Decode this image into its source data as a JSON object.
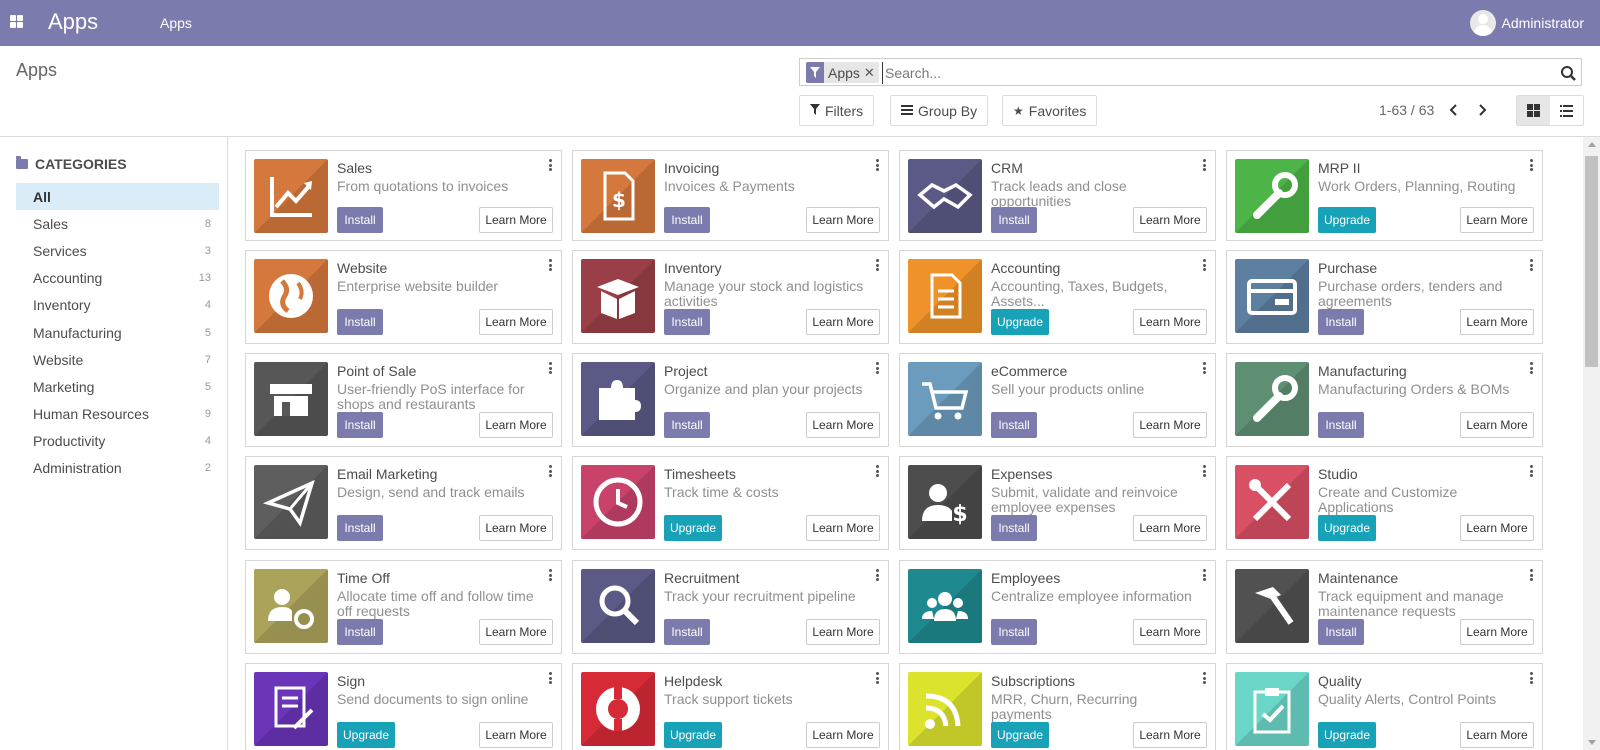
{
  "navbar": {
    "brand": "Apps",
    "menu_item": "Apps",
    "user": "Administrator",
    "color": "#7c7bad"
  },
  "control": {
    "title": "Apps",
    "search": {
      "facet": "Apps",
      "placeholder": "Search..."
    },
    "buttons": {
      "filters": "Filters",
      "group_by": "Group By",
      "favorites": "Favorites"
    },
    "pager": "1-63 / 63",
    "view": "kanban"
  },
  "sidebar": {
    "header": "CATEGORIES",
    "items": [
      {
        "label": "All",
        "count": "",
        "active": true
      },
      {
        "label": "Sales",
        "count": "8"
      },
      {
        "label": "Services",
        "count": "3"
      },
      {
        "label": "Accounting",
        "count": "13"
      },
      {
        "label": "Inventory",
        "count": "4"
      },
      {
        "label": "Manufacturing",
        "count": "5"
      },
      {
        "label": "Website",
        "count": "7"
      },
      {
        "label": "Marketing",
        "count": "5"
      },
      {
        "label": "Human Resources",
        "count": "9"
      },
      {
        "label": "Productivity",
        "count": "4"
      },
      {
        "label": "Administration",
        "count": "2"
      }
    ]
  },
  "learn_more_label": "Learn More",
  "apps": [
    {
      "name": "Sales",
      "summary": "From quotations to invoices",
      "action": "Install",
      "color": "#d4783d",
      "icon": "chart-icon"
    },
    {
      "name": "Invoicing",
      "summary": "Invoices & Payments",
      "action": "Install",
      "color": "#d4783d",
      "icon": "invoice-icon"
    },
    {
      "name": "CRM",
      "summary": "Track leads and close opportunities",
      "action": "Install",
      "color": "#5b5a86",
      "icon": "handshake-icon"
    },
    {
      "name": "MRP II",
      "summary": "Work Orders, Planning, Routing",
      "action": "Upgrade",
      "color": "#4db547",
      "icon": "wrench-icon"
    },
    {
      "name": "Website",
      "summary": "Enterprise website builder",
      "action": "Install",
      "color": "#d4783d",
      "icon": "globe-icon"
    },
    {
      "name": "Inventory",
      "summary": "Manage your stock and logistics activities",
      "action": "Install",
      "color": "#9a3f47",
      "icon": "box-icon"
    },
    {
      "name": "Accounting",
      "summary": "Accounting, Taxes, Budgets, Assets...",
      "action": "Upgrade",
      "color": "#f0922a",
      "icon": "document-icon"
    },
    {
      "name": "Purchase",
      "summary": "Purchase orders, tenders and agreements",
      "action": "Install",
      "color": "#5d7fa0",
      "icon": "card-icon"
    },
    {
      "name": "Point of Sale",
      "summary": "User-friendly PoS interface for shops and restaurants",
      "action": "Install",
      "color": "#575757",
      "icon": "store-icon"
    },
    {
      "name": "Project",
      "summary": "Organize and plan your projects",
      "action": "Install",
      "color": "#5b5a86",
      "icon": "puzzle-icon"
    },
    {
      "name": "eCommerce",
      "summary": "Sell your products online",
      "action": "Install",
      "color": "#6b9bbd",
      "icon": "cart-icon"
    },
    {
      "name": "Manufacturing",
      "summary": "Manufacturing Orders & BOMs",
      "action": "Install",
      "color": "#5f8f73",
      "icon": "wrench-icon"
    },
    {
      "name": "Email Marketing",
      "summary": "Design, send and track emails",
      "action": "Install",
      "color": "#5e5e5e",
      "icon": "paper-plane-icon"
    },
    {
      "name": "Timesheets",
      "summary": "Track time & costs",
      "action": "Upgrade",
      "color": "#c8426a",
      "icon": "clock-icon"
    },
    {
      "name": "Expenses",
      "summary": "Submit, validate and reinvoice employee expenses",
      "action": "Install",
      "color": "#4d4d4d",
      "icon": "person-dollar-icon"
    },
    {
      "name": "Studio",
      "summary": "Create and Customize Applications",
      "action": "Upgrade",
      "color": "#d94f63",
      "icon": "tools-icon"
    },
    {
      "name": "Time Off",
      "summary": "Allocate time off and follow time off requests",
      "action": "Install",
      "color": "#aca35a",
      "icon": "person-gear-icon"
    },
    {
      "name": "Recruitment",
      "summary": "Track your recruitment pipeline",
      "action": "Install",
      "color": "#5b5a86",
      "icon": "magnifier-icon"
    },
    {
      "name": "Employees",
      "summary": "Centralize employee information",
      "action": "Install",
      "color": "#1e8a8f",
      "icon": "people-icon"
    },
    {
      "name": "Maintenance",
      "summary": "Track equipment and manage maintenance requests",
      "action": "Install",
      "color": "#515151",
      "icon": "hammer-icon"
    },
    {
      "name": "Sign",
      "summary": "Send documents to sign online",
      "action": "Upgrade",
      "color": "#6a35b8",
      "icon": "sign-icon"
    },
    {
      "name": "Helpdesk",
      "summary": "Track support tickets",
      "action": "Upgrade",
      "color": "#d62b36",
      "icon": "lifebuoy-icon"
    },
    {
      "name": "Subscriptions",
      "summary": "MRR, Churn, Recurring payments",
      "action": "Upgrade",
      "color": "#dbe32d",
      "icon": "rss-icon"
    },
    {
      "name": "Quality",
      "summary": "Quality Alerts, Control Points",
      "action": "Upgrade",
      "color": "#6ad6c8",
      "icon": "clipboard-check-icon"
    }
  ]
}
